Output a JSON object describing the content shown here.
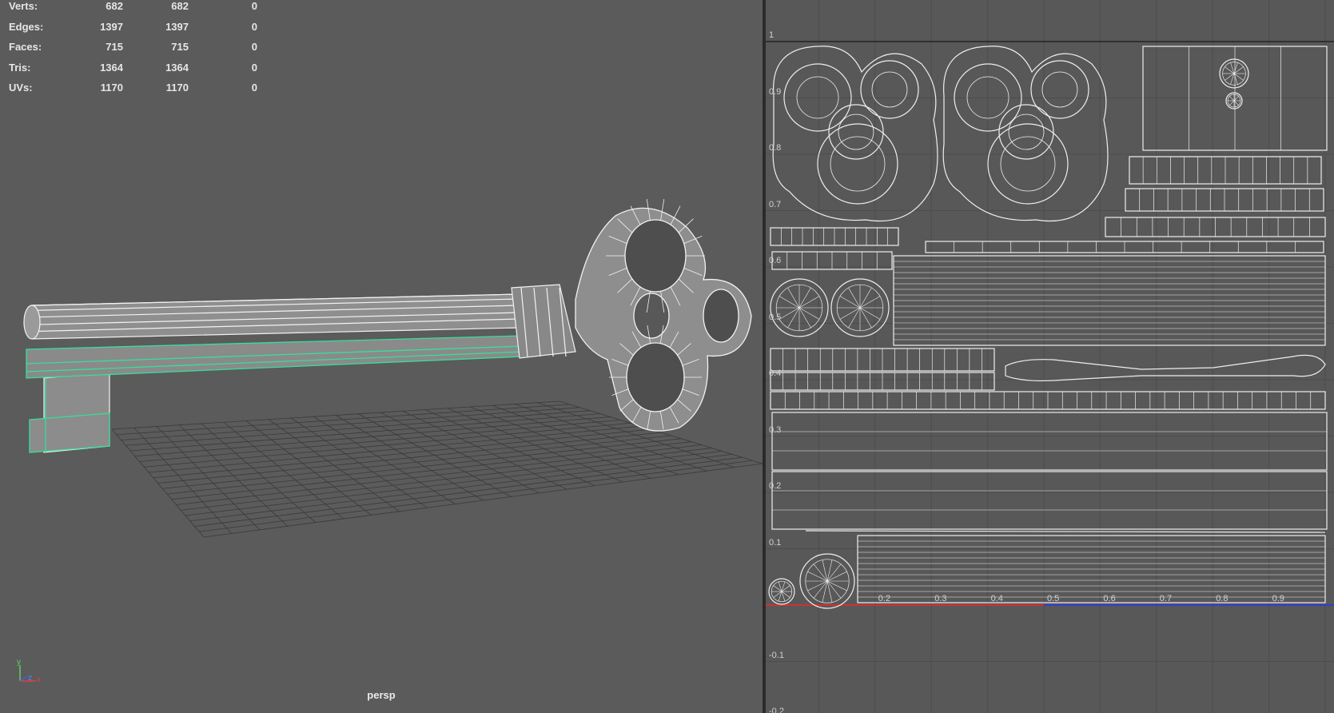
{
  "hud": {
    "rows": [
      {
        "label": "Verts:",
        "v1": "682",
        "v2": "682",
        "v3": "0"
      },
      {
        "label": "Edges:",
        "v1": "1397",
        "v2": "1397",
        "v3": "0"
      },
      {
        "label": "Faces:",
        "v1": "715",
        "v2": "715",
        "v3": "0"
      },
      {
        "label": "Tris:",
        "v1": "1364",
        "v2": "1364",
        "v3": "0"
      },
      {
        "label": "UVs:",
        "v1": "1170",
        "v2": "1170",
        "v3": "0"
      }
    ]
  },
  "viewport": {
    "camera": "persp",
    "axis": {
      "y": "y",
      "x": "x",
      "z": "z"
    }
  },
  "uv_editor": {
    "v_labels": [
      "1",
      "0.9",
      "0.8",
      "0.7",
      "0.6",
      "0.5",
      "0.4",
      "0.3",
      "0.2",
      "0.1",
      "-0.1",
      "-0.2"
    ],
    "u_labels": [
      "0.2",
      "0.3",
      "0.4",
      "0.5",
      "0.6",
      "0.7",
      "0.8",
      "0.9"
    ]
  },
  "colors": {
    "selection": "#35e09a",
    "u_axis": "#d03030",
    "v_axis": "#3040d0"
  }
}
